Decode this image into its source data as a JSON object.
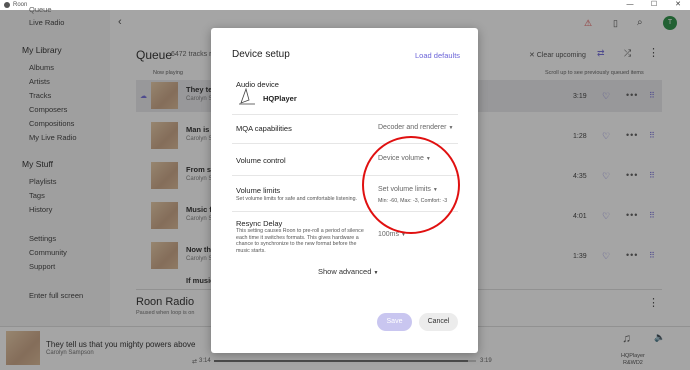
{
  "window": {
    "title": "Roon",
    "minimize": "—",
    "maximize": "☐",
    "close": "✕"
  },
  "sidebar": {
    "partial_top": "Queue",
    "live_radio": "Live Radio",
    "my_library_heading": "My Library",
    "library_items": [
      "Albums",
      "Artists",
      "Tracks",
      "Composers",
      "Compositions",
      "My Live Radio"
    ],
    "my_stuff_heading": "My Stuff",
    "stuff_items": [
      "Playlists",
      "Tags",
      "History"
    ],
    "bottom_items": [
      "Settings",
      "Community",
      "Support"
    ],
    "fullscreen": "Enter full screen"
  },
  "topbar": {
    "avatar_letter": "T"
  },
  "queue": {
    "title": "Queue",
    "count": "6472 tracks re",
    "now_playing": "Now playing",
    "clear": "✕ Clear upcoming",
    "scroll_hint": "Scroll up to see previously queued items",
    "rows": [
      {
        "title": "They tel",
        "artist": "Carolyn Sa",
        "composer": "Composer",
        "added": "Added",
        "duration": "3:19"
      },
      {
        "title": "Man is f",
        "artist": "Carolyn Sa",
        "composer": "Composer",
        "added": "Added",
        "duration": "1:28"
      },
      {
        "title": "From sil",
        "artist": "Carolyn Sa",
        "composer": "Composer",
        "added": "Added",
        "duration": "4:35"
      },
      {
        "title": "Music fo",
        "artist": "Carolyn Sa",
        "composer": "Composer",
        "added": "Added",
        "duration": "4:01"
      },
      {
        "title": "Now the",
        "artist": "Carolyn Sa",
        "composer": "Composer",
        "added": "Added",
        "duration": "1:39"
      },
      {
        "title": "If music",
        "artist": "",
        "composer": "",
        "added": "",
        "duration": ""
      }
    ],
    "roon_radio": "Roon Radio",
    "radio_sub": "Paused when loop is on"
  },
  "nowplaying": {
    "title": "They tell us that you mighty powers above",
    "artist": "Carolyn Sampson",
    "elapsed": "3:14",
    "total": "3:19",
    "zone_line1": "HQPlayer",
    "zone_line2": "R&WD2",
    "progress_fraction": 0.97
  },
  "modal": {
    "title": "Device setup",
    "load_defaults": "Load defaults",
    "audio_device_label": "Audio device",
    "device_name": "HQPlayer",
    "mqa_label": "MQA capabilities",
    "mqa_value": "Decoder and renderer",
    "volume_control_label": "Volume control",
    "volume_control_value": "Device volume",
    "volume_limits_label": "Volume limits",
    "volume_limits_desc": "Set volume limits for safe and comfortable listening.",
    "volume_limits_value": "Set volume limits",
    "volume_limits_detail": "Min: -60, Max: -3, Comfort: -3",
    "resync_label": "Resync Delay",
    "resync_desc": "This setting causes Roon to pre-roll a period of silence each time it switches formats. This gives hardware a chance to synchronize to the new format before the music starts.",
    "resync_value": "100ms",
    "show_advanced": "Show advanced",
    "save": "Save",
    "cancel": "Cancel"
  },
  "colors": {
    "accent": "#6b64d8",
    "highlight_circle": "#e01010",
    "save_disabled": "#c9c6f0"
  }
}
